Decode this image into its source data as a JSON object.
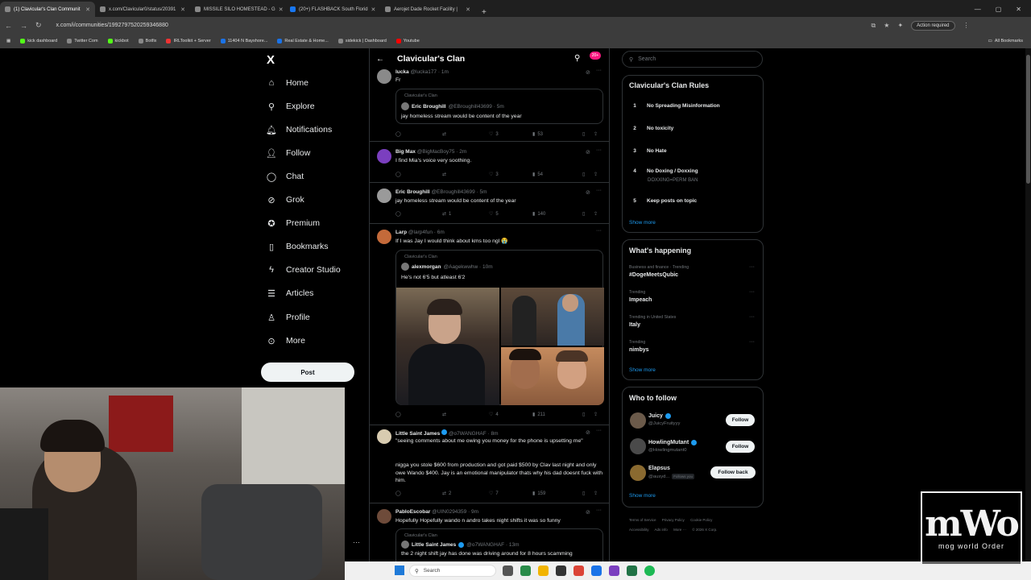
{
  "browser": {
    "tabs": [
      {
        "label": "(1) Clavicular's Clan Communit"
      },
      {
        "label": "x.com/Clavicular0/status/20391"
      },
      {
        "label": "MISSILE SILO HOMESTEAD - G"
      },
      {
        "label": "(20+) FLASHBACK South Florid"
      },
      {
        "label": "Aerojet Dade Rocket Facility |"
      }
    ],
    "new_tab": "+",
    "url": "x.com/i/communities/1992797520259346880",
    "action_required": "Action required",
    "bookmarks": [
      "kick dashboard",
      "Twitter Com",
      "kickbot",
      "Botfix",
      "IRLToolkit + Server",
      "11404 N Bayshore...",
      "Real Estate & Home...",
      "sidekick | Dashboard",
      "Youtube"
    ],
    "all_bookmarks": "All Bookmarks"
  },
  "nav": {
    "logo": "X",
    "items": [
      "Home",
      "Explore",
      "Notifications",
      "Follow",
      "Chat",
      "Grok",
      "Premium",
      "Bookmarks",
      "Creator Studio",
      "Articles",
      "Profile",
      "More"
    ],
    "post_label": "Post"
  },
  "community": {
    "title": "Clavicular's Clan",
    "badge": "20+"
  },
  "tweets": [
    {
      "name": "lucka",
      "handle": "@lucka177 · 1m",
      "text": "Fr",
      "quote": {
        "clan": "Clavicular's Clan",
        "name": "Eric Broughill",
        "handle": "@EBroughill43699 · 5m",
        "text": "jay homeless stream would be content of the year"
      },
      "likes": "3",
      "views": "53",
      "retweets": ""
    },
    {
      "name": "Big Max",
      "handle": "@BigMacBoy75 · 2m",
      "text": "I find Mia's voice very soothing.",
      "likes": "3",
      "views": "54",
      "retweets": ""
    },
    {
      "name": "Eric Broughill",
      "handle": "@EBroughill43699 · 5m",
      "text": "jay homeless stream would be content of the year",
      "likes": "5",
      "views": "140",
      "retweets": "1"
    },
    {
      "name": "Larp",
      "handle": "@larp4fun · 6m",
      "text": "If I was Jay I would think about kms too ngl 😭",
      "quote": {
        "clan": "Clavicular's Clan",
        "name": "alexmorgan",
        "handle": "@Aagekwwhw · 10m",
        "text": "He's not 6'5 but atleast 6'2"
      },
      "likes": "4",
      "views": "211",
      "retweets": ""
    },
    {
      "name": "Little Saint James",
      "handle": "@o7WANGHAF · 8m",
      "text": "\"seeing comments about me owing you money for the phone is upsetting me\"",
      "text2": "nigga you stole $600 from production and got paid $500 by Clav last night and only owe Wando $400. Jay is an emotional manipulator thats why his dad doesnt fuck with him.",
      "likes": "7",
      "views": "159",
      "retweets": "2"
    },
    {
      "name": "PabloEscobar",
      "handle": "@UIN0294359 · 9m",
      "text": "Hopefully Hopefully wando n andro takes night shifts it was so funny",
      "quote": {
        "clan": "Clavicular's Clan",
        "name": "Little Saint James",
        "handle": "@o7WANGHAF · 13m",
        "text": "the 2 night shift jay has done was driving around for 8 hours scamming"
      }
    }
  ],
  "right": {
    "search_placeholder": "Search",
    "rules_title": "Clavicular's Clan Rules",
    "rules": [
      {
        "n": "1",
        "text": "No Spreading Misinformation",
        "sub": ""
      },
      {
        "n": "2",
        "text": "No toxicity",
        "sub": ""
      },
      {
        "n": "3",
        "text": "No Hate",
        "sub": ""
      },
      {
        "n": "4",
        "text": "No Doxing / Doxxing",
        "sub": "DOXXING=PERM BAN"
      },
      {
        "n": "5",
        "text": "Keep posts on topic",
        "sub": ""
      }
    ],
    "show_more": "Show more",
    "happening_title": "What's happening",
    "trends": [
      {
        "cat": "Business and finance · Trending",
        "name": "#DogeMeetsQubic"
      },
      {
        "cat": "Trending",
        "name": "Impeach"
      },
      {
        "cat": "Trending in United States",
        "name": "Italy"
      },
      {
        "cat": "Trending",
        "name": "nimbys"
      }
    ],
    "wtf_title": "Who to follow",
    "wtf": [
      {
        "name": "Juicy",
        "handle": "@JuicyFruityyy",
        "btn": "Follow",
        "follows_you": ""
      },
      {
        "name": "HowlingMutant",
        "handle": "@Howlingmutant0",
        "btn": "Follow",
        "follows_you": ""
      },
      {
        "name": "Elapsus",
        "handle": "@ausyd...",
        "btn": "Follow back",
        "follows_you": "Follows you"
      }
    ],
    "footer": [
      "Terms of Service",
      "Privacy Policy",
      "Cookie Policy",
      "Accessibility",
      "Ads info",
      "More ···",
      "© 2026 X Corp."
    ]
  },
  "taskbar": {
    "search": "Search"
  },
  "watermark": {
    "big": "mWo",
    "small": "mog world Order"
  }
}
